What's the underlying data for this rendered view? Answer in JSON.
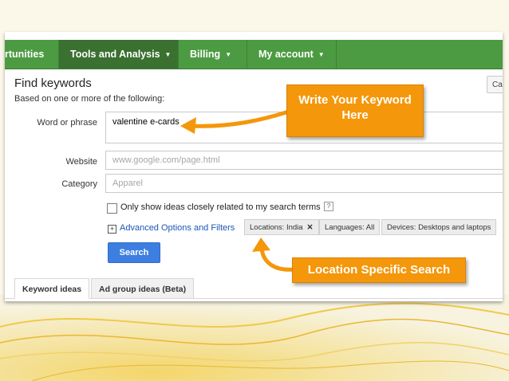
{
  "nav": {
    "items": [
      {
        "label": "rtunities",
        "caret": ""
      },
      {
        "label": "Tools and Analysis",
        "caret": "▼"
      },
      {
        "label": "Billing",
        "caret": "▼"
      },
      {
        "label": "My account",
        "caret": "▼"
      }
    ]
  },
  "page": {
    "title": "Find keywords",
    "subtitle": "Based on one or more of the following:",
    "cancel_label": "Can"
  },
  "form": {
    "word_label": "Word or phrase",
    "word_value": "valentine e-cards",
    "website_label": "Website",
    "website_placeholder": "www.google.com/page.html",
    "category_label": "Category",
    "category_placeholder": "Apparel",
    "checkbox_label": "Only show ideas closely related to my search terms",
    "help": "?",
    "plus": "+",
    "advanced_link": "Advanced Options and Filters",
    "chips": {
      "locations": "Locations: India",
      "locations_remove": "✕",
      "languages": "Languages: All",
      "devices": "Devices: Desktops and laptops"
    },
    "search_label": "Search"
  },
  "tabs": [
    "Keyword ideas",
    "Ad group ideas (Beta)"
  ],
  "callouts": {
    "keyword_line1": "Write Your Keyword",
    "keyword_line2": "Here",
    "location": "Location Specific Search"
  },
  "colors": {
    "nav_green": "#4c9b42",
    "nav_active": "#3a7030",
    "callout_orange": "#f4970a",
    "search_blue": "#3d7fe0",
    "link_blue": "#1d56b7"
  }
}
